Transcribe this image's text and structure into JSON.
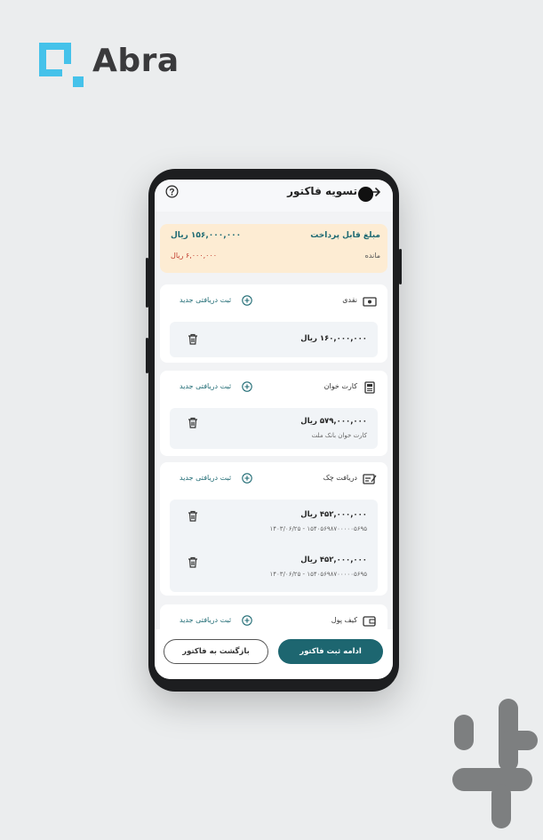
{
  "brand": {
    "name": "Abra",
    "logo_color": "#45c2ea"
  },
  "screen": {
    "title": "تسویه فاکتور",
    "icons": {
      "back": "back-arrow-icon",
      "help": "help-icon"
    },
    "payable": {
      "label": "مبلغ قابل پرداخت",
      "amount": "۱۵۶,۰۰۰,۰۰۰ ریال",
      "remaining_label": "مانده",
      "remaining_amount": "۶,۰۰۰,۰۰۰ ریال",
      "bg_color": "#fdecd3",
      "remaining_color": "#c0392b"
    },
    "add_label": "ثبت دریافتی جدید",
    "sections": {
      "cash": {
        "title": "نقدی",
        "icon": "cash-icon",
        "entries": [
          {
            "amount": "۱۶۰,۰۰۰,۰۰۰ ریال"
          }
        ]
      },
      "pos": {
        "title": "کارت خوان",
        "icon": "pos-terminal-icon",
        "entries": [
          {
            "amount": "۵۷۹,۰۰۰,۰۰۰ ریال",
            "detail": "کارت خوان بانک ملت"
          }
        ]
      },
      "cheque": {
        "title": "دریافت چک",
        "icon": "cheque-icon",
        "entries": [
          {
            "amount": "۴۵۲,۰۰۰,۰۰۰ ریال",
            "detail": "۱۵۴۰۵۶۹۸۷۰۰۰۰۰۵۶۹۵ - ۱۴۰۳/۰۶/۲۵"
          },
          {
            "amount": "۴۵۲,۰۰۰,۰۰۰ ریال",
            "detail": "۱۵۴۰۵۶۹۸۷۰۰۰۰۰۵۶۹۵ - ۱۴۰۳/۰۶/۲۵"
          }
        ]
      },
      "wallet": {
        "title": "کیف پول",
        "icon": "wallet-icon"
      }
    },
    "buttons": {
      "continue": "ادامه ثبت فاکتور",
      "back_to_invoice": "بازگشت به فاکتور"
    },
    "accent_color": "#1d6670"
  },
  "store_badge": {
    "icon": "bazaar-logo-icon"
  }
}
